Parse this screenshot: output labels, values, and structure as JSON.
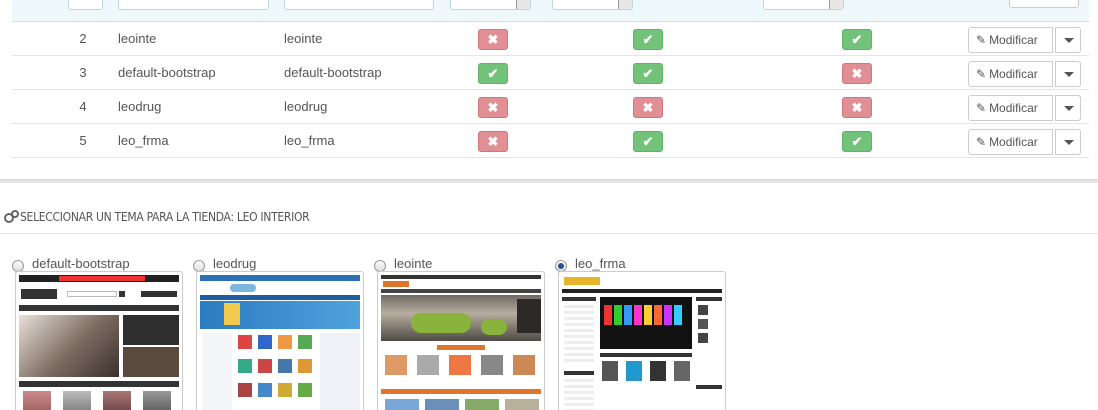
{
  "table": {
    "rows": [
      {
        "id": "2",
        "name": "leointe",
        "directory": "leointe",
        "status": [
          "off",
          "on",
          "on"
        ],
        "edit_label": "Modificar"
      },
      {
        "id": "3",
        "name": "default-bootstrap",
        "directory": "default-bootstrap",
        "status": [
          "on",
          "on",
          "off"
        ],
        "edit_label": "Modificar"
      },
      {
        "id": "4",
        "name": "leodrug",
        "directory": "leodrug",
        "status": [
          "off",
          "off",
          "off"
        ],
        "edit_label": "Modificar"
      },
      {
        "id": "5",
        "name": "leo_frma",
        "directory": "leo_frma",
        "status": [
          "off",
          "on",
          "on"
        ],
        "edit_label": "Modificar"
      }
    ]
  },
  "section": {
    "title": "SELECCIONAR UN TEMA PARA LA TIENDA: LEO INTERIOR"
  },
  "themes": [
    {
      "name": "default-bootstrap",
      "selected": false
    },
    {
      "name": "leodrug",
      "selected": false
    },
    {
      "name": "leointe",
      "selected": false
    },
    {
      "name": "leo_frma",
      "selected": true
    }
  ],
  "colors": {
    "status_on": "#72c279",
    "status_off": "#e08f95",
    "filter_bg": "#eef8fb"
  },
  "icons": {
    "status_on": "✔",
    "status_off": "✖",
    "edit": "✎"
  }
}
